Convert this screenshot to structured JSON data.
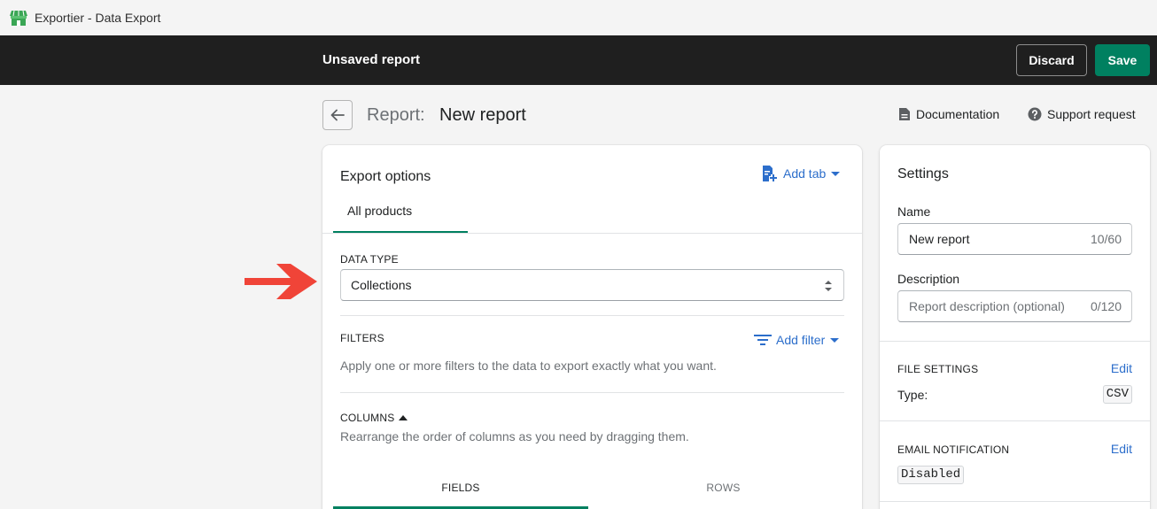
{
  "window": {
    "title": "Exportier - Data Export"
  },
  "context_bar": {
    "title": "Unsaved report",
    "discard_label": "Discard",
    "save_label": "Save"
  },
  "header": {
    "title_prefix": "Report:",
    "title": "New report",
    "documentation_label": "Documentation",
    "support_label": "Support request"
  },
  "export_options": {
    "title": "Export options",
    "add_tab_label": "Add tab",
    "tabs": [
      {
        "label": "All products",
        "active": true
      }
    ],
    "data_type": {
      "label": "DATA TYPE",
      "value": "Collections"
    },
    "filters": {
      "label": "FILTERS",
      "add_filter_label": "Add filter",
      "help": "Apply one or more filters to the data to export exactly what you want."
    },
    "columns": {
      "label": "COLUMNS",
      "help": "Rearrange the order of columns as you need by dragging them.",
      "subtabs": [
        {
          "label": "FIELDS",
          "active": true
        },
        {
          "label": "ROWS",
          "active": false
        }
      ]
    }
  },
  "settings": {
    "title": "Settings",
    "name": {
      "label": "Name",
      "value": "New report",
      "count": "10/60"
    },
    "description": {
      "label": "Description",
      "placeholder": "Report description (optional)",
      "count": "0/120"
    },
    "file_settings": {
      "label": "FILE SETTINGS",
      "edit_label": "Edit",
      "type_label": "Type:",
      "type_value": "CSV"
    },
    "email_notification": {
      "label": "EMAIL NOTIFICATION",
      "edit_label": "Edit",
      "status": "Disabled"
    }
  },
  "colors": {
    "primary_green": "#008060",
    "link_blue": "#2c6ecb",
    "annotation_red": "#f04438",
    "dark_bar": "#1f1f1f"
  },
  "icons": [
    "storefront-icon",
    "arrow-left-icon",
    "document-icon",
    "question-circle-icon",
    "add-tab-icon",
    "filter-lines-icon",
    "select-updown-icon",
    "red-arrow-annotation"
  ]
}
